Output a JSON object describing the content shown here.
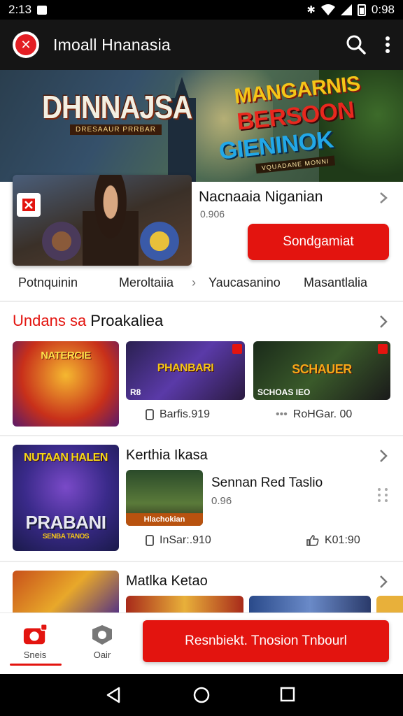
{
  "status_bar": {
    "time": "2:13",
    "clock_right": "0:98"
  },
  "app_bar": {
    "title": "Imoall Hnanasia"
  },
  "hero": {
    "left_title": "DHNNAJSA",
    "left_subtitle": "DRESAAUR PRRBAR",
    "badge_line1": "MANGARNIS",
    "badge_line2": "BERSOON",
    "badge_line3": "GIENINOK",
    "badge_line4": "VQUADANE MONNI"
  },
  "promo": {
    "title": "Nacnaaia Niganian",
    "meta": "0.906",
    "button_label": "Sondgamiat"
  },
  "category_tabs": [
    "Potnquinin",
    "Meroltaiia",
    "Yaucasanino",
    "Masantlalia"
  ],
  "section1": {
    "title_red": "Undans sa",
    "title_rest": " Proakaliea",
    "thumbs": [
      {
        "title": "NATERCIE",
        "caption": ""
      },
      {
        "title": "PHANBARI",
        "caption": "R8"
      },
      {
        "title": "SCHAUER",
        "caption": "SCHOAS IEO"
      }
    ],
    "meta_left": "Barfis.919",
    "meta_right": "RoHGar. 00"
  },
  "section2": {
    "title": "Kerthia Ikasa",
    "big_thumb_title": "PRABANI",
    "big_thumb_top": "NUTAAN HALEN",
    "big_thumb_sub": "SENBA TANOS",
    "item_title": "Sennan Red Taslio",
    "item_meta": "0.96",
    "item_thumb_caption": "Hlachokian",
    "meta_left": "InSar:.910",
    "meta_right": "K01:90"
  },
  "section3": {
    "title": "Matlka Ketao"
  },
  "bottom_nav": {
    "item1_label": "Sneis",
    "item2_label": "Oair",
    "cta_label": "Resnbiekt. Tnosion Tnbourl"
  },
  "colors": {
    "accent": "#e3140f",
    "appbar": "#151515"
  }
}
